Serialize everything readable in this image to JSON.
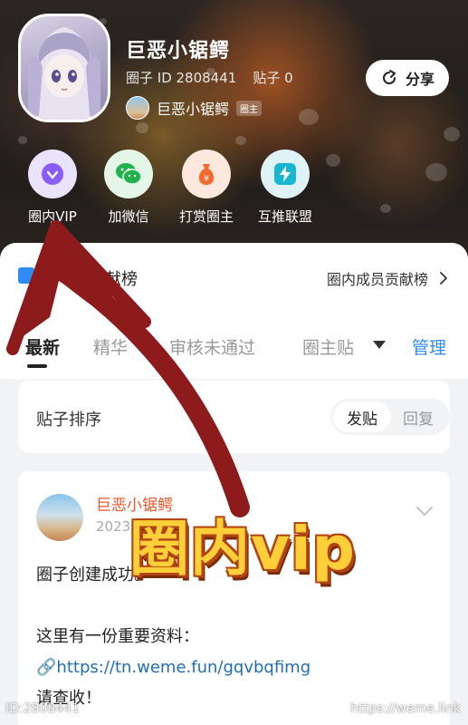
{
  "header": {
    "circle_name": "巨恶小锯鳄",
    "circle_id": "圈子 ID 2808441",
    "post_count": "贴子 0",
    "owner_name": "巨恶小锯鳄",
    "owner_tag": "圈主",
    "share_label": "分享"
  },
  "quick_actions": [
    {
      "label": "圈内VIP",
      "icon": "diamond-icon",
      "bg": "#e9e3fb",
      "fg": "#8b5cf6"
    },
    {
      "label": "加微信",
      "icon": "wechat-icon",
      "bg": "#e3f6e8",
      "fg": "#22b14c"
    },
    {
      "label": "打赏圈主",
      "icon": "money-bag-icon",
      "bg": "#fde8dd",
      "fg": "#f26a2e"
    },
    {
      "label": "互推联盟",
      "icon": "lightning-icon",
      "bg": "#dff3f7",
      "fg": "#19b6d1"
    }
  ],
  "contrib": {
    "title": "员贡献榜",
    "link": "圈内成员贡献榜"
  },
  "tabs": {
    "items": [
      "最新",
      "精华",
      "审核未通过",
      "圈主贴"
    ],
    "manage": "管理"
  },
  "sort": {
    "label": "贴子排序",
    "options": [
      "发贴",
      "回复"
    ]
  },
  "post": {
    "author": "巨恶小锯鳄",
    "date": "2023",
    "line1": "圈子创建成功。",
    "line2": "这里有一份重要资料：",
    "link": "https://tn.weme.fun/gqvbqfimg",
    "line3": "请查收！"
  },
  "overlay": {
    "promo_text": "圈内vip"
  },
  "watermarks": {
    "left": "ID:2808441",
    "right": "https://weme.link"
  },
  "colors": {
    "accent_blue": "#2f8cf5",
    "author_red": "#e8572e",
    "arrow_red": "#8e1b1b"
  }
}
